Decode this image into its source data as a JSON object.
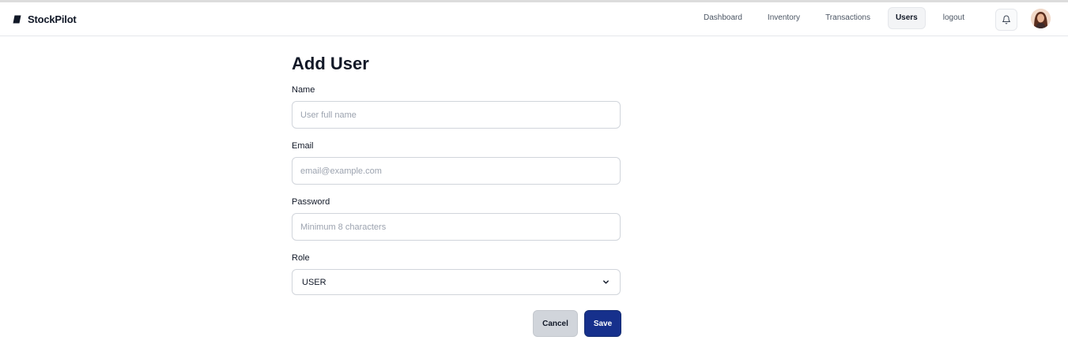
{
  "app": {
    "name": "StockPilot",
    "logo_icon": "brand-logo-icon"
  },
  "nav": {
    "items": [
      {
        "label": "Dashboard",
        "active": false
      },
      {
        "label": "Inventory",
        "active": false
      },
      {
        "label": "Transactions",
        "active": false
      },
      {
        "label": "Users",
        "active": true
      },
      {
        "label": "logout",
        "active": false
      }
    ],
    "notification_icon": "bell-icon",
    "avatar_icon": "user-avatar"
  },
  "page": {
    "title": "Add User"
  },
  "form": {
    "name": {
      "label": "Name",
      "placeholder": "User full name",
      "value": ""
    },
    "email": {
      "label": "Email",
      "placeholder": "email@example.com",
      "value": ""
    },
    "password": {
      "label": "Password",
      "placeholder": "Minimum 8 characters",
      "value": ""
    },
    "role": {
      "label": "Role",
      "value": "USER",
      "icon": "chevron-down-icon"
    },
    "cancel_label": "Cancel",
    "save_label": "Save"
  },
  "colors": {
    "primary": "#16308c",
    "cancel_bg": "#d1d5db",
    "border": "#d1d5db",
    "text": "#111827"
  }
}
